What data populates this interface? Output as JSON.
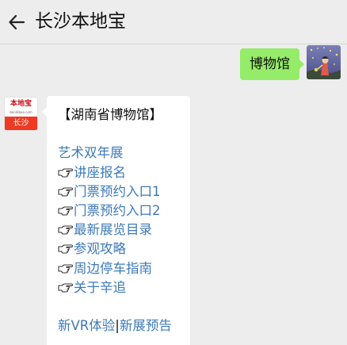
{
  "header": {
    "title": "长沙本地宝"
  },
  "messages": {
    "outgoing": {
      "text": "博物馆"
    },
    "incoming": {
      "heading": "【湖南省博物馆】",
      "intro_link": "艺术双年展",
      "links": [
        "讲座报名",
        "门票预约入口1",
        "门票预约入口2",
        "最新展览目录",
        "参观攻略",
        "周边停车指南",
        "关于辛追"
      ],
      "footer_link_1": "新VR体验",
      "footer_separator": "|",
      "footer_link_2": "新展预告"
    }
  },
  "avatars": {
    "official_logo_text": "本地宝",
    "official_logo_url": "bendibao.com",
    "official_city": "长沙"
  },
  "icons": {
    "back": "back-arrow-icon",
    "bullet": "pointing-hand-icon"
  },
  "colors": {
    "background": "#ededed",
    "outgoing_bubble": "#95ec69",
    "incoming_bubble": "#ffffff",
    "link": "#3d7ab8",
    "avatar_orange": "#ee3a22"
  }
}
